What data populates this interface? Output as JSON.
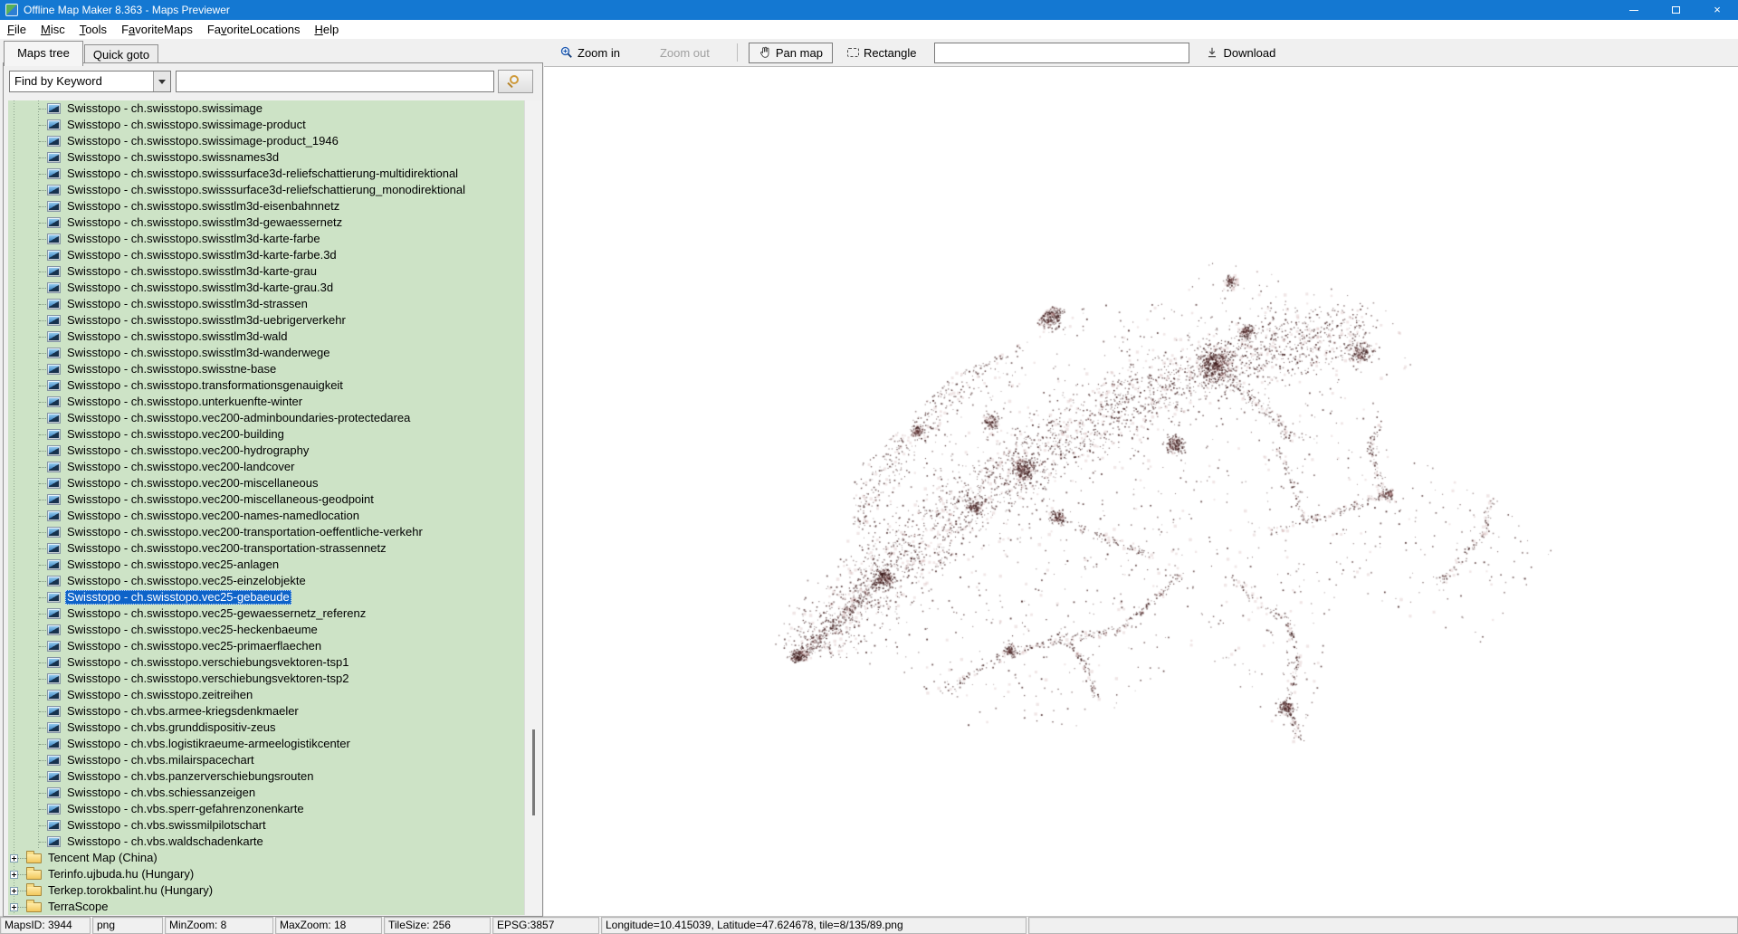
{
  "window": {
    "title": "Offline Map Maker 8.363 - Maps Previewer",
    "controls": [
      "minimize",
      "maximize",
      "close"
    ]
  },
  "menu": {
    "items": [
      {
        "label": "File",
        "underline": 0
      },
      {
        "label": "Misc",
        "underline": 0
      },
      {
        "label": "Tools",
        "underline": 0
      },
      {
        "label": "FavoriteMaps",
        "underline": 1
      },
      {
        "label": "FavoriteLocations",
        "underline": 2
      },
      {
        "label": "Help",
        "underline": 0
      }
    ]
  },
  "tabs": [
    {
      "label": "Maps tree",
      "active": true
    },
    {
      "label": "Quick goto",
      "active": false
    }
  ],
  "search": {
    "filter_value": "Find by Keyword",
    "query_value": ""
  },
  "toolbar": {
    "zoom_in": "Zoom in",
    "zoom_out": "Zoom out",
    "pan": "Pan map",
    "rectangle": "Rectangle",
    "input_value": "",
    "download": "Download"
  },
  "tree": {
    "selected_index": 30,
    "items": [
      "Swisstopo - ch.swisstopo.swissimage",
      "Swisstopo - ch.swisstopo.swissimage-product",
      "Swisstopo - ch.swisstopo.swissimage-product_1946",
      "Swisstopo - ch.swisstopo.swissnames3d",
      "Swisstopo - ch.swisstopo.swisssurface3d-reliefschattierung-multidirektional",
      "Swisstopo - ch.swisstopo.swisssurface3d-reliefschattierung_monodirektional",
      "Swisstopo - ch.swisstopo.swisstlm3d-eisenbahnnetz",
      "Swisstopo - ch.swisstopo.swisstlm3d-gewaessernetz",
      "Swisstopo - ch.swisstopo.swisstlm3d-karte-farbe",
      "Swisstopo - ch.swisstopo.swisstlm3d-karte-farbe.3d",
      "Swisstopo - ch.swisstopo.swisstlm3d-karte-grau",
      "Swisstopo - ch.swisstopo.swisstlm3d-karte-grau.3d",
      "Swisstopo - ch.swisstopo.swisstlm3d-strassen",
      "Swisstopo - ch.swisstopo.swisstlm3d-uebrigerverkehr",
      "Swisstopo - ch.swisstopo.swisstlm3d-wald",
      "Swisstopo - ch.swisstopo.swisstlm3d-wanderwege",
      "Swisstopo - ch.swisstopo.swisstne-base",
      "Swisstopo - ch.swisstopo.transformationsgenauigkeit",
      "Swisstopo - ch.swisstopo.unterkuenfte-winter",
      "Swisstopo - ch.swisstopo.vec200-adminboundaries-protectedarea",
      "Swisstopo - ch.swisstopo.vec200-building",
      "Swisstopo - ch.swisstopo.vec200-hydrography",
      "Swisstopo - ch.swisstopo.vec200-landcover",
      "Swisstopo - ch.swisstopo.vec200-miscellaneous",
      "Swisstopo - ch.swisstopo.vec200-miscellaneous-geodpoint",
      "Swisstopo - ch.swisstopo.vec200-names-namedlocation",
      "Swisstopo - ch.swisstopo.vec200-transportation-oeffentliche-verkehr",
      "Swisstopo - ch.swisstopo.vec200-transportation-strassennetz",
      "Swisstopo - ch.swisstopo.vec25-anlagen",
      "Swisstopo - ch.swisstopo.vec25-einzelobjekte",
      "Swisstopo - ch.swisstopo.vec25-gebaeude",
      "Swisstopo - ch.swisstopo.vec25-gewaessernetz_referenz",
      "Swisstopo - ch.swisstopo.vec25-heckenbaeume",
      "Swisstopo - ch.swisstopo.vec25-primaerflaechen",
      "Swisstopo - ch.swisstopo.verschiebungsvektoren-tsp1",
      "Swisstopo - ch.swisstopo.verschiebungsvektoren-tsp2",
      "Swisstopo - ch.swisstopo.zeitreihen",
      "Swisstopo - ch.vbs.armee-kriegsdenkmaeler",
      "Swisstopo - ch.vbs.grunddispositiv-zeus",
      "Swisstopo - ch.vbs.logistikraeume-armeelogistikcenter",
      "Swisstopo - ch.vbs.milairspacechart",
      "Swisstopo - ch.vbs.panzerverschiebungsrouten",
      "Swisstopo - ch.vbs.schiessanzeigen",
      "Swisstopo - ch.vbs.sperr-gefahrenzonenkarte",
      "Swisstopo - ch.vbs.swissmilpilotschart",
      "Swisstopo - ch.vbs.waldschadenkarte"
    ],
    "folders": [
      "Tencent Map (China)",
      "Terinfo.ujbuda.hu (Hungary)",
      "Terkep.torokbalint.hu (Hungary)",
      "TerraScope"
    ]
  },
  "map": {
    "depicts": "Switzerland building-density dot map preview",
    "dot_color": "#3a1616"
  },
  "status": {
    "panels": [
      "MapsID: 3944",
      "png",
      "MinZoom: 8",
      "MaxZoom: 18",
      "TileSize: 256",
      "EPSG:3857",
      "Longitude=10.415039, Latitude=47.624678, tile=8/135/89.png"
    ]
  },
  "colors": {
    "titlebar": "#1478d2",
    "selection": "#0e63c9",
    "tree_bg": "#cde3c6"
  }
}
